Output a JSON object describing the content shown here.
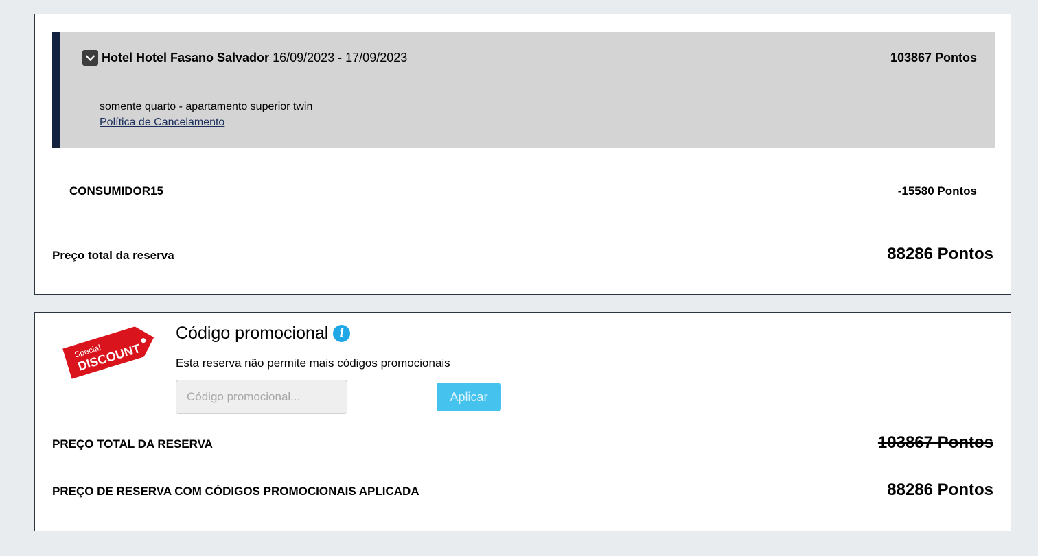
{
  "summary": {
    "hotel_prefix": "Hotel Hotel Fasano Salvador",
    "dates": "16/09/2023 - 17/09/2023",
    "hotel_points": "103867 Pontos",
    "room_desc": "somente quarto - apartamento superior twin",
    "cancel_link": "Política de Cancelamento",
    "coupon_code": "CONSUMIDOR15",
    "coupon_points": "-15580 Pontos",
    "total_label": "Preço total da reserva",
    "total_value": "88286 Pontos"
  },
  "promo": {
    "badge_text_top": "Special",
    "badge_text_main": "DISCOUNT",
    "title": "Código promocional",
    "note": "Esta reserva não permite mais códigos promocionais",
    "input_placeholder": "Código promocional...",
    "apply_label": "Aplicar",
    "total_label": "PREÇO TOTAL DA RESERVA",
    "total_value_original": "103867 Pontos",
    "discounted_label": "PREÇO DE RESERVA COM CÓDIGOS PROMOCIONAIS APLICADA",
    "discounted_value": "88286 Pontos"
  },
  "colors": {
    "accent_bar": "#13213f",
    "apply_button": "#45c3ee",
    "info_icon": "#20a8e6",
    "badge_red": "#d9141c"
  }
}
